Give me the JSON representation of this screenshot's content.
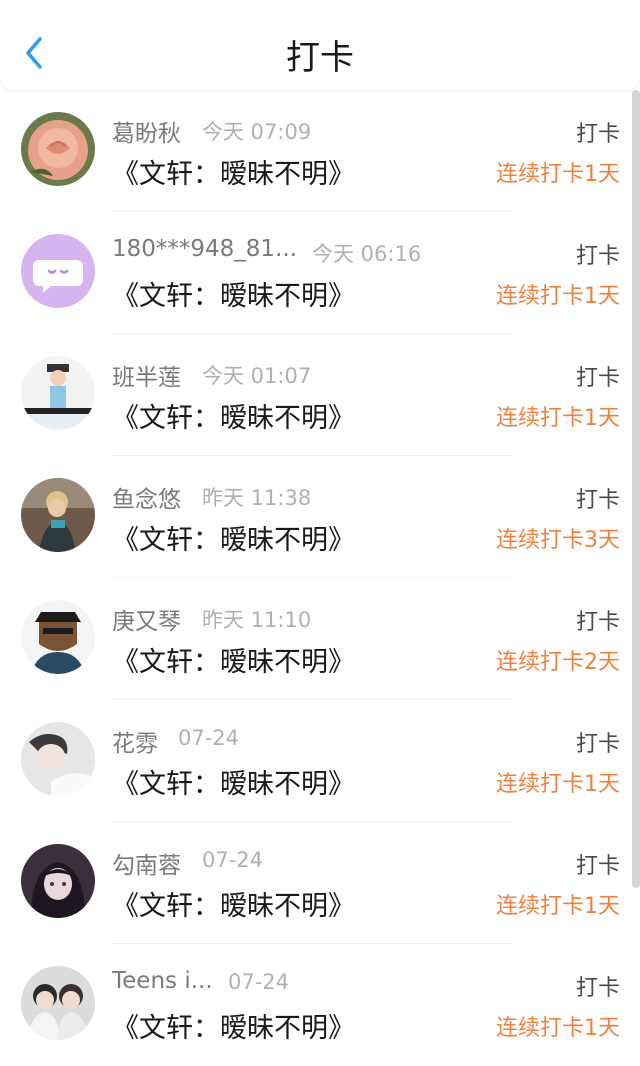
{
  "header": {
    "title": "打卡",
    "back_icon": "chevron-left-icon",
    "accent": "#2a9ef0"
  },
  "items": [
    {
      "name": "葛盼秋",
      "time": "今天 07:09",
      "book": "《文轩：暧昧不明》",
      "kind": "打卡",
      "streak": "连续打卡1天",
      "avatar": "rose-photo"
    },
    {
      "name": "180***948_81...",
      "time": "今天 06:16",
      "book": "《文轩：暧昧不明》",
      "kind": "打卡",
      "streak": "连续打卡1天",
      "avatar": "chat-bubble-avatar"
    },
    {
      "name": "班半莲",
      "time": "今天 01:07",
      "book": "《文轩：暧昧不明》",
      "kind": "打卡",
      "streak": "连续打卡1天",
      "avatar": "cartoon-boy-photo"
    },
    {
      "name": "鱼念悠",
      "time": "昨天 11:38",
      "book": "《文轩：暧昧不明》",
      "kind": "打卡",
      "streak": "连续打卡3天",
      "avatar": "person-photo"
    },
    {
      "name": "庚又琴",
      "time": "昨天 11:10",
      "book": "《文轩：暧昧不明》",
      "kind": "打卡",
      "streak": "连续打卡2天",
      "avatar": "cartoon-man-photo"
    },
    {
      "name": "花雰",
      "time": "07-24",
      "book": "《文轩：暧昧不明》",
      "kind": "打卡",
      "streak": "连续打卡1天",
      "avatar": "portrait-photo"
    },
    {
      "name": "勾南蓉",
      "time": "07-24",
      "book": "《文轩：暧昧不明》",
      "kind": "打卡",
      "streak": "连续打卡1天",
      "avatar": "anime-girl-photo"
    },
    {
      "name": "Teens i...",
      "time": "07-24",
      "book": "《文轩：暧昧不明》",
      "kind": "打卡",
      "streak": "连续打卡1天",
      "avatar": "group-photo"
    }
  ]
}
